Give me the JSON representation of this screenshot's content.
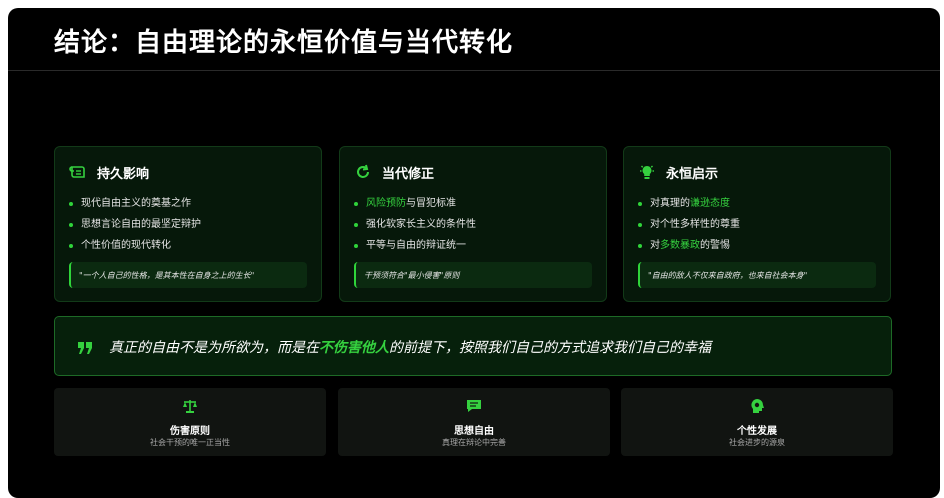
{
  "title": "结论：自由理论的永恒价值与当代转化",
  "cards": [
    {
      "icon": "scroll-icon",
      "title": "持久影响",
      "items": [
        {
          "pre": "现代自由主义的奠基之作",
          "hl": "",
          "post": ""
        },
        {
          "pre": "思想言论自由的最坚定辩护",
          "hl": "",
          "post": ""
        },
        {
          "pre": "个性价值的现代转化",
          "hl": "",
          "post": ""
        }
      ],
      "quote": "\"一个人自己的性格，是其本性在自身之上的生长\""
    },
    {
      "icon": "refresh-icon",
      "title": "当代修正",
      "items": [
        {
          "pre": "",
          "hl": "风险预防",
          "post": "与冒犯标准"
        },
        {
          "pre": "强化软家长主义的条件性",
          "hl": "",
          "post": ""
        },
        {
          "pre": "平等与自由的辩证统一",
          "hl": "",
          "post": ""
        }
      ],
      "quote": "干预须符合\"最小侵害\"原则"
    },
    {
      "icon": "lightbulb-icon",
      "title": "永恒启示",
      "items": [
        {
          "pre": "对真理的",
          "hl": "谦逊态度",
          "post": ""
        },
        {
          "pre": "对个性多样性的尊重",
          "hl": "",
          "post": ""
        },
        {
          "pre": "对",
          "hl": "多数暴政",
          "post": "的警惕"
        }
      ],
      "quote": "\"自由的敌人不仅来自政府，也来自社会本身\""
    }
  ],
  "banner": {
    "icon": "quote-icon",
    "pre": "真正的自由不是为所欲为，而是在",
    "em": "不伤害他人",
    "post": "的前提下，按照我们自己的方式追求我们自己的幸福"
  },
  "principles": [
    {
      "icon": "balance-scale-icon",
      "name": "伤害原则",
      "desc": "社会干预的唯一正当性"
    },
    {
      "icon": "comment-icon",
      "name": "思想自由",
      "desc": "真理在辩论中完善"
    },
    {
      "icon": "head-bulb-icon",
      "name": "个性发展",
      "desc": "社会进步的源泉"
    }
  ],
  "colors": {
    "accent": "#35d13f",
    "background": "#000000",
    "card": "#06180a"
  }
}
